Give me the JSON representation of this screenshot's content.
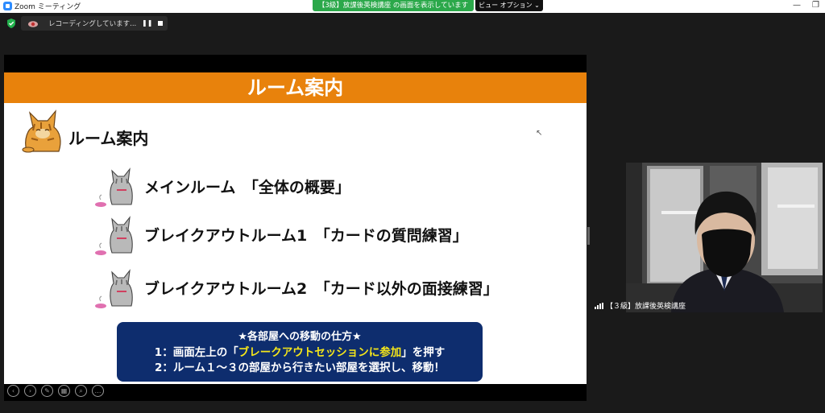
{
  "window": {
    "title": "Zoom ミーティング",
    "share_banner": "【3級】放課後英検講座 の画面を表示しています",
    "view_button": "ビュー オプション ⌄",
    "min_glyph": "—",
    "restore_glyph": "❐"
  },
  "recording": {
    "status_text": "レコーディングしています...",
    "pause_glyph": "❚❚"
  },
  "slide": {
    "header": "ルーム案内",
    "section_title": "ルーム案内",
    "rooms": [
      {
        "label": "メインルーム　「全体の概要」"
      },
      {
        "label": "ブレイクアウトルーム1　「カードの質問練習」"
      },
      {
        "label": "ブレイクアウトルーム2　「カード以外の面接練習」"
      }
    ],
    "info": {
      "title": "★各部屋への移動の仕方★",
      "line1_prefix": "1：画面左上の「",
      "line1_highlight": "ブレークアウトセッションに参加",
      "line1_suffix": "」を押す",
      "line2": "2：ルーム１～３の部屋から行きたい部屋を選択し、移動！"
    },
    "colors": {
      "header": "#E8820C",
      "info_box": "#0E2D6E",
      "highlight": "#F5E61A"
    }
  },
  "participant": {
    "name": "【３級】放課後英検講座"
  }
}
